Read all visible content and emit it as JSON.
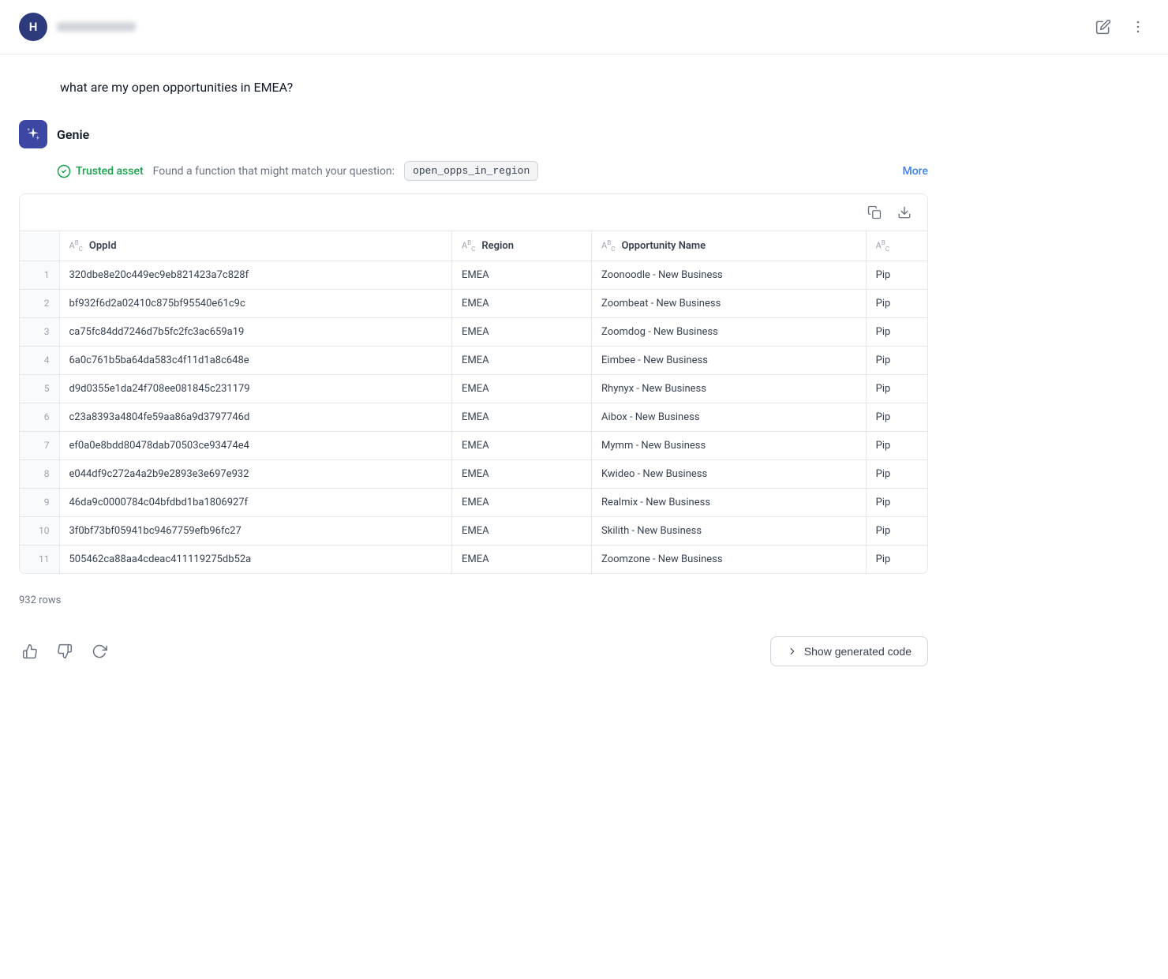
{
  "header": {
    "avatar_letter": "H",
    "username_blurred": true,
    "edit_icon": "✏",
    "more_icon": "⋮"
  },
  "user_message": {
    "text": "what are my open opportunities in EMEA?"
  },
  "genie": {
    "name": "Genie",
    "trusted_asset_label": "Trusted asset",
    "found_text": "Found a function that might match your question:",
    "function_name": "open_opps_in_region",
    "more_label": "More"
  },
  "table": {
    "columns": [
      {
        "id": "row_num",
        "label": "",
        "type": ""
      },
      {
        "id": "opp_id",
        "label": "OppId",
        "type": "ABC"
      },
      {
        "id": "region",
        "label": "Region",
        "type": "ABC"
      },
      {
        "id": "opp_name",
        "label": "Opportunity Name",
        "type": "ABC"
      },
      {
        "id": "partial",
        "label": "...",
        "type": "ABC"
      }
    ],
    "rows": [
      {
        "num": "1",
        "opp_id": "320dbe8e20c449ec9eb821423a7c828f",
        "region": "EMEA",
        "opp_name": "Zoonoodle - New Business",
        "partial": "Pip"
      },
      {
        "num": "2",
        "opp_id": "bf932f6d2a02410c875bf95540e61c9c",
        "region": "EMEA",
        "opp_name": "Zoombeat - New Business",
        "partial": "Pip"
      },
      {
        "num": "3",
        "opp_id": "ca75fc84dd7246d7b5fc2fc3ac659a19",
        "region": "EMEA",
        "opp_name": "Zoomdog - New Business",
        "partial": "Pip"
      },
      {
        "num": "4",
        "opp_id": "6a0c761b5ba64da583c4f11d1a8c648e",
        "region": "EMEA",
        "opp_name": "Eimbee - New Business",
        "partial": "Pip"
      },
      {
        "num": "5",
        "opp_id": "d9d0355e1da24f708ee081845c231179",
        "region": "EMEA",
        "opp_name": "Rhynyx - New Business",
        "partial": "Pip"
      },
      {
        "num": "6",
        "opp_id": "c23a8393a4804fe59aa86a9d3797746d",
        "region": "EMEA",
        "opp_name": "Aibox - New Business",
        "partial": "Pip"
      },
      {
        "num": "7",
        "opp_id": "ef0a0e8bdd80478dab70503ce93474e4",
        "region": "EMEA",
        "opp_name": "Mymm - New Business",
        "partial": "Pip"
      },
      {
        "num": "8",
        "opp_id": "e044df9c272a4a2b9e2893e3e697e932",
        "region": "EMEA",
        "opp_name": "Kwideo - New Business",
        "partial": "Pip"
      },
      {
        "num": "9",
        "opp_id": "46da9c0000784c04bfdbd1ba1806927f",
        "region": "EMEA",
        "opp_name": "Realmix - New Business",
        "partial": "Pip"
      },
      {
        "num": "10",
        "opp_id": "3f0bf73bf05941bc9467759efb96fc27",
        "region": "EMEA",
        "opp_name": "Skilith - New Business",
        "partial": "Pip"
      },
      {
        "num": "11",
        "opp_id": "505462ca88aa4cdeac411119275db52a",
        "region": "EMEA",
        "opp_name": "Zoomzone - New Business",
        "partial": "Pip"
      }
    ],
    "row_count": "932 rows"
  },
  "footer": {
    "thumbs_up_label": "thumbs up",
    "thumbs_down_label": "thumbs down",
    "refresh_label": "refresh",
    "show_code_label": "Show generated code"
  }
}
